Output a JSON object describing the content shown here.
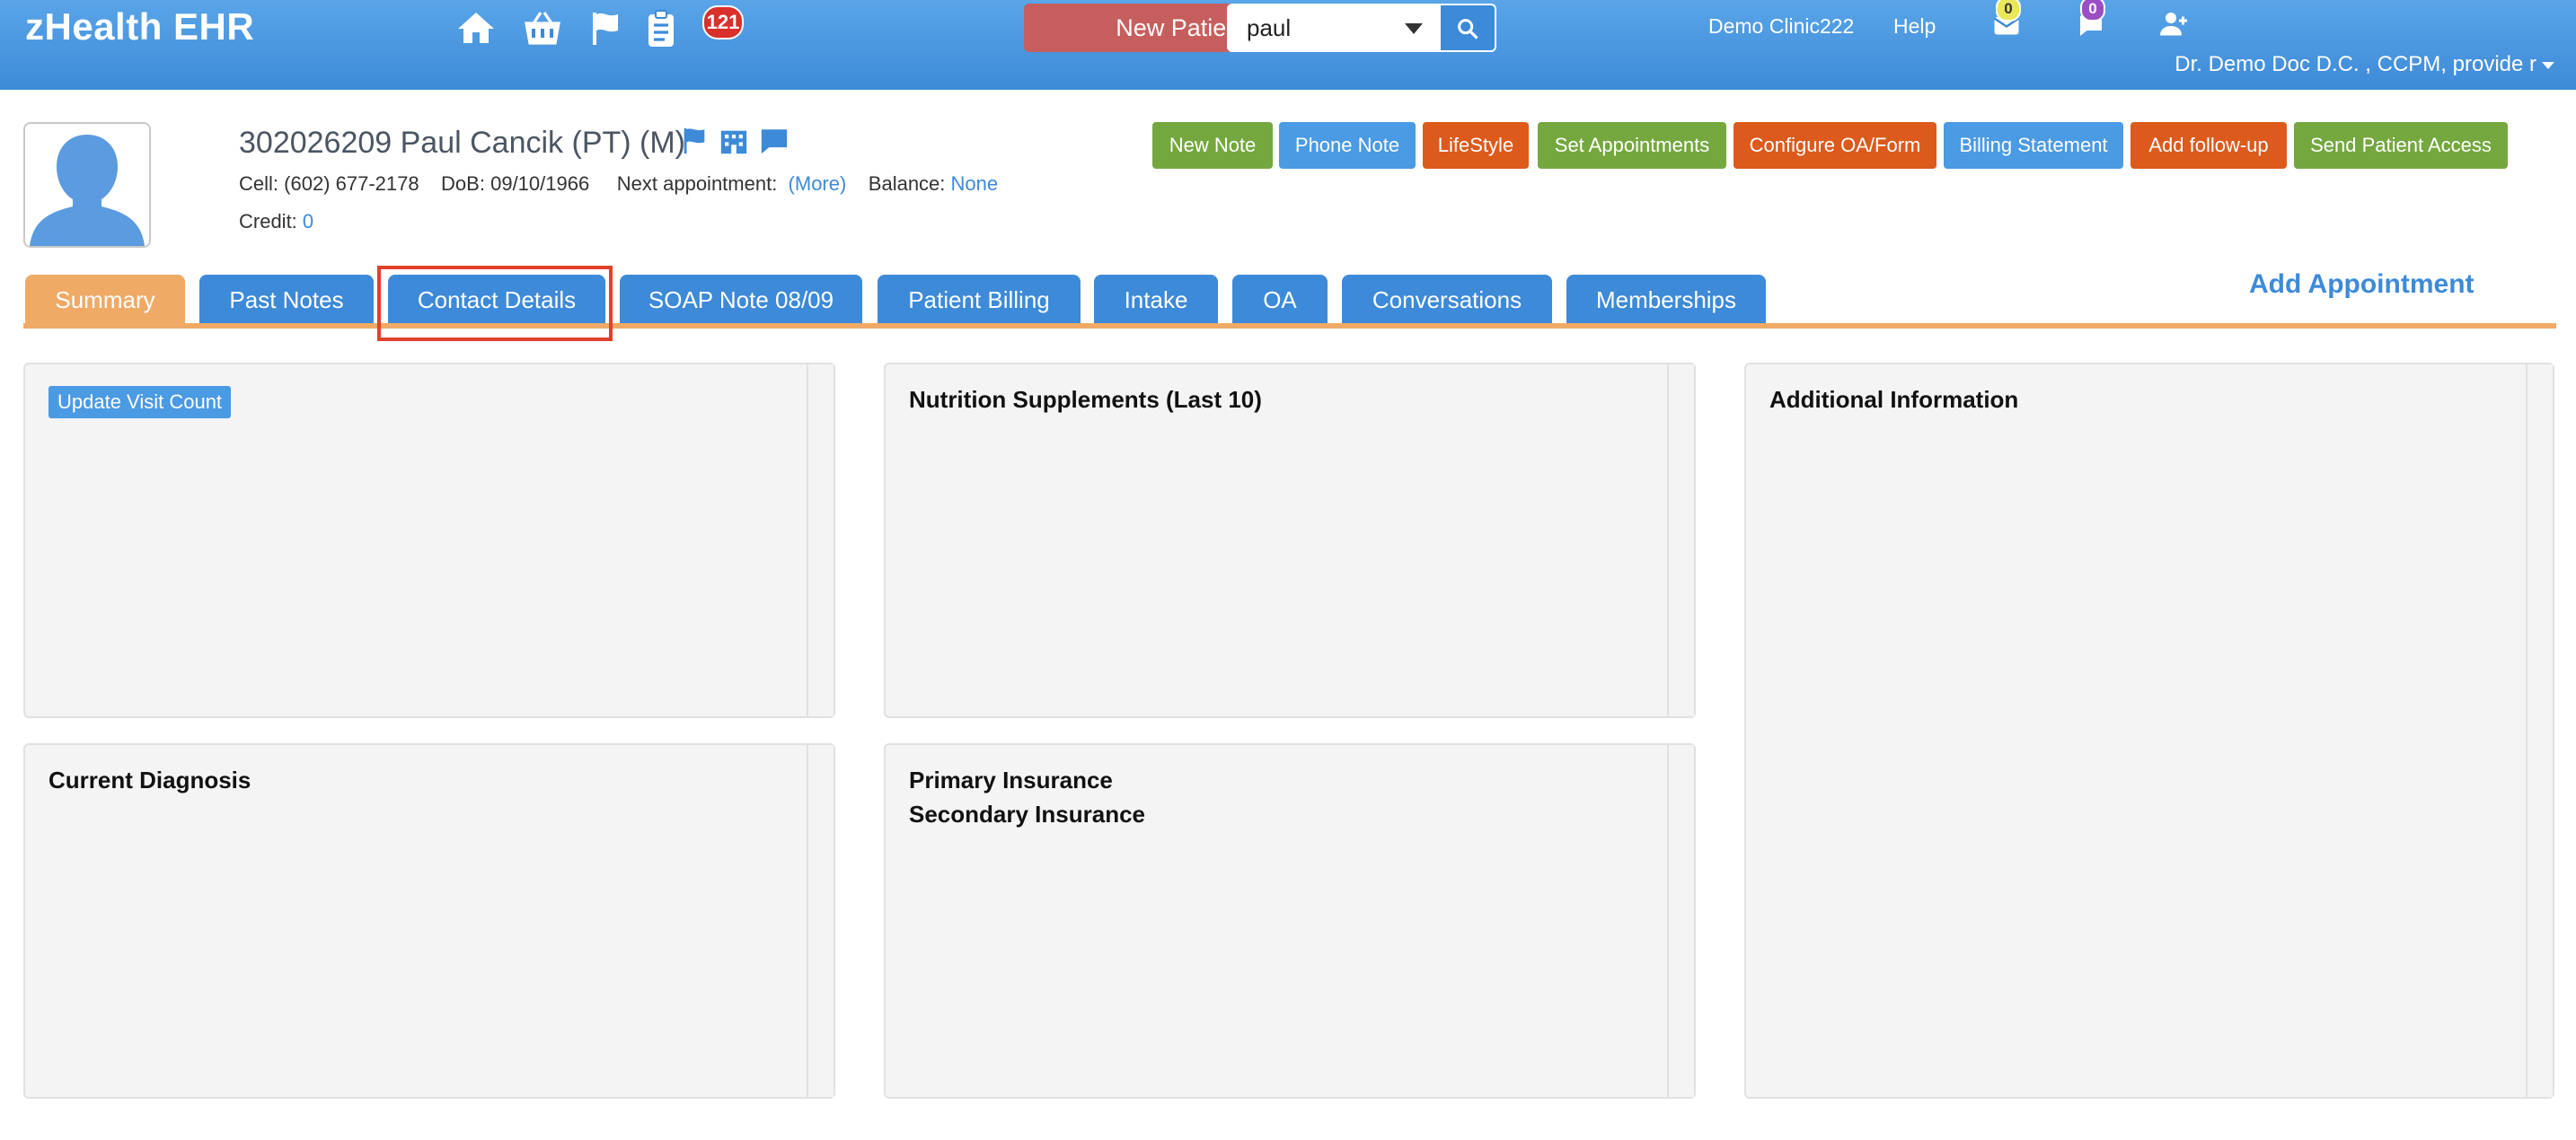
{
  "app": {
    "brand": "zHealth EHR",
    "nav_icons": [
      "home-icon",
      "basket-icon",
      "flag-icon",
      "clipboard-icon"
    ],
    "task_badge": "121",
    "new_patient_label": "New Patient",
    "search": {
      "value": "paul"
    },
    "clinic": "Demo Clinic222",
    "help": "Help",
    "mail_badge": "0",
    "chat_badge": "0",
    "user": "Dr. Demo Doc D.C. , CCPM, provide r"
  },
  "patient": {
    "title": "302026209 Paul Cancik  (PT) (M)",
    "cell_label": "Cell:",
    "cell": "(602) 677-2178",
    "dob_label": "DoB:",
    "dob": "09/10/1966",
    "next_appt_label": "Next appointment:",
    "next_appt_link": "(More)",
    "balance_label": "Balance:",
    "balance": "None",
    "credit_label": "Credit:",
    "credit": "0"
  },
  "actions": [
    "New Note",
    "Phone Note",
    "LifeStyle",
    "Set Appointments",
    "Configure OA/Form",
    "Billing Statement",
    "Add follow-up",
    "Send Patient Access"
  ],
  "tabs": [
    "Summary",
    "Past Notes",
    "Contact Details",
    "SOAP Note 08/09",
    "Patient Billing",
    "Intake",
    "OA",
    "Conversations",
    "Memberships"
  ],
  "add_appointment": "Add Appointment",
  "panels": {
    "update_visit_count": "Update Visit Count",
    "nutrition": "Nutrition Supplements (Last 10)",
    "additional_info": "Additional Information",
    "current_diagnosis": "Current Diagnosis",
    "primary_insurance": "Primary Insurance",
    "secondary_insurance": "Secondary Insurance"
  },
  "colors": {
    "header_blue": "#3d8ad8",
    "tab_active": "#efaa66",
    "new_patient_red": "#c75e5e",
    "btn_green": "#74a83f",
    "btn_blue": "#4a9ae4",
    "btn_orange": "#dc5a1c",
    "highlight_red": "#e0412b"
  }
}
